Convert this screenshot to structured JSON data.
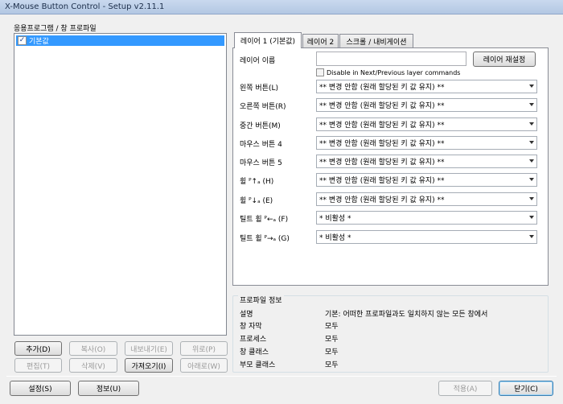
{
  "window": {
    "title": "X-Mouse Button Control - Setup v2.11.1"
  },
  "profiles": {
    "group_label": "응용프로그램 / 창 프로파일",
    "items": [
      {
        "label": "기본값",
        "checked": true
      }
    ]
  },
  "profile_buttons": {
    "add": "추가(D)",
    "copy": "복사(O)",
    "export": "내보내기(E)",
    "up": "위로(P)",
    "edit": "편집(T)",
    "delete": "삭제(V)",
    "import": "가져오기(I)",
    "down": "아래로(W)"
  },
  "tabs": [
    {
      "label": "레이어 1 (기본값)",
      "active": true
    },
    {
      "label": "레이어 2",
      "active": false
    },
    {
      "label": "스크롤 / 내비게이션",
      "active": false
    }
  ],
  "layer": {
    "name_label": "레이어 이름",
    "name_value": "",
    "reset_button": "레이어 재설정",
    "disable_check_label": "Disable in Next/Previous layer commands"
  },
  "mappings": [
    {
      "label": "왼쪽 버튼(L)",
      "value": "** 변경 안함 (원래 할당된 키 값 유지) **"
    },
    {
      "label": "오른쪽 버튼(R)",
      "value": "** 변경 안함 (원래 할당된 키 값 유지) **"
    },
    {
      "label": "중간 버튼(M)",
      "value": "** 변경 안함 (원래 할당된 키 값 유지) **"
    },
    {
      "label": "마우스 버튼 4",
      "value": "** 변경 안함 (원래 할당된 키 값 유지) **"
    },
    {
      "label": "마우스 버튼 5",
      "value": "** 변경 안함 (원래 할당된 키 값 유지) **"
    },
    {
      "label": "휠 ᴾ↑ₐ (H)",
      "value": "** 변경 안함 (원래 할당된 키 값 유지) **"
    },
    {
      "label": "휠 ᴾ↓ₐ (E)",
      "value": "** 변경 안함 (원래 할당된 키 값 유지) **"
    },
    {
      "label": "틸트 휠 ᴾ←ₐ (F)",
      "value": "* 비활성 *"
    },
    {
      "label": "틸트 휠 ᴾ→ₐ (G)",
      "value": "* 비활성 *"
    }
  ],
  "profile_info": {
    "group_label": "프로파일 정보",
    "rows": [
      {
        "key": "설명",
        "value": "기본: 어떠한 프로파일과도 일치하지 않는 모든 창에서"
      },
      {
        "key": "창 자막",
        "value": "모두"
      },
      {
        "key": "프로세스",
        "value": "모두"
      },
      {
        "key": "창 클래스",
        "value": "모두"
      },
      {
        "key": "부모 클래스",
        "value": "모두"
      }
    ]
  },
  "footer": {
    "settings": "설정(S)",
    "info": "정보(U)",
    "apply": "적용(A)",
    "close": "닫기(C)"
  }
}
